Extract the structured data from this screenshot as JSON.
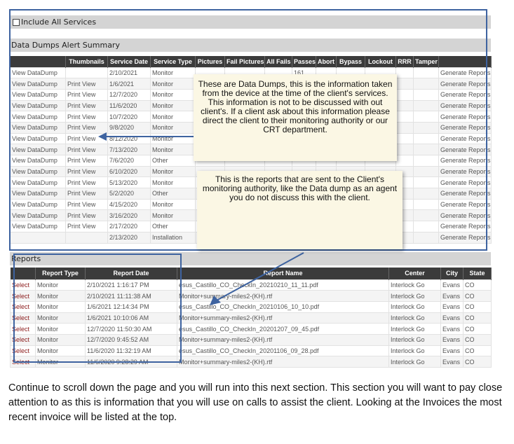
{
  "include_toggle": {
    "label": "Include All Services"
  },
  "data_dumps": {
    "title": "Data Dumps Alert Summary",
    "columns": [
      "",
      "Thumbnails",
      "Service Date",
      "Service Type",
      "Pictures",
      "Fail Pictures",
      "All Fails",
      "Passes",
      "Abort",
      "Bypass",
      "Lockout",
      "RRR",
      "Tamper",
      ""
    ],
    "rows": [
      {
        "view": "View DataDump",
        "thumb": "",
        "date": "2/10/2021",
        "type": "Monitor",
        "passes": "161",
        "gen": "Generate Reports"
      },
      {
        "view": "View DataDump",
        "thumb": "Print View",
        "date": "1/6/2021",
        "type": "Monitor",
        "passes": "",
        "gen": "Generate Reports"
      },
      {
        "view": "View DataDump",
        "thumb": "Print View",
        "date": "12/7/2020",
        "type": "Monitor",
        "passes": "",
        "gen": "Generate Reports"
      },
      {
        "view": "View DataDump",
        "thumb": "Print View",
        "date": "11/6/2020",
        "type": "Monitor",
        "passes": "",
        "gen": "Generate Reports"
      },
      {
        "view": "View DataDump",
        "thumb": "Print View",
        "date": "10/7/2020",
        "type": "Monitor",
        "passes": "",
        "gen": "Generate Reports"
      },
      {
        "view": "View DataDump",
        "thumb": "Print View",
        "date": "9/8/2020",
        "type": "Monitor",
        "passes": "",
        "gen": "Generate Reports"
      },
      {
        "view": "View DataDump",
        "thumb": "Print View",
        "date": "8/12/2020",
        "type": "Monitor",
        "passes": "",
        "gen": "Generate Reports"
      },
      {
        "view": "View DataDump",
        "thumb": "Print View",
        "date": "7/13/2020",
        "type": "Monitor",
        "passes": "",
        "gen": "Generate Reports"
      },
      {
        "view": "View DataDump",
        "thumb": "Print View",
        "date": "7/6/2020",
        "type": "Other",
        "passes": "",
        "gen": "Generate Reports"
      },
      {
        "view": "View DataDump",
        "thumb": "Print View",
        "date": "6/10/2020",
        "type": "Monitor",
        "passes": "",
        "gen": "Generate Reports"
      },
      {
        "view": "View DataDump",
        "thumb": "Print View",
        "date": "5/13/2020",
        "type": "Monitor",
        "passes": "",
        "gen": "Generate Reports"
      },
      {
        "view": "View DataDump",
        "thumb": "Print View",
        "date": "5/2/2020",
        "type": "Other",
        "passes": "",
        "gen": "Generate Reports"
      },
      {
        "view": "View DataDump",
        "thumb": "Print View",
        "date": "4/15/2020",
        "type": "Monitor",
        "passes": "",
        "gen": "Generate Reports"
      },
      {
        "view": "View DataDump",
        "thumb": "Print View",
        "date": "3/16/2020",
        "type": "Monitor",
        "passes": "",
        "gen": "Generate Reports"
      },
      {
        "view": "View DataDump",
        "thumb": "Print View",
        "date": "2/17/2020",
        "type": "Other",
        "passes": "",
        "gen": "Generate Reports"
      },
      {
        "view": "",
        "thumb": "",
        "date": "2/13/2020",
        "type": "Installation",
        "passes": "",
        "gen": "Generate Reports"
      }
    ]
  },
  "reports": {
    "title": "Reports",
    "columns": [
      "",
      "Report Type",
      "Report Date",
      "Report Name",
      "Center",
      "City",
      "State"
    ],
    "rows": [
      {
        "sel": "Select",
        "type": "Monitor",
        "date": "2/10/2021 1:16:17 PM",
        "name": "esus_Castillo_CO_CheckIn_20210210_11_11.pdf",
        "center": "Interlock Go",
        "city": "Evans",
        "state": "CO"
      },
      {
        "sel": "Select",
        "type": "Monitor",
        "date": "2/10/2021 11:11:38 AM",
        "name": "Monitor+summary-miles2-(KH).rtf",
        "center": "Interlock Go",
        "city": "Evans",
        "state": "CO"
      },
      {
        "sel": "Select",
        "type": "Monitor",
        "date": "1/6/2021 12:14:34 PM",
        "name": "esus_Castillo_CO_CheckIn_20210106_10_10.pdf",
        "center": "Interlock Go",
        "city": "Evans",
        "state": "CO"
      },
      {
        "sel": "Select",
        "type": "Monitor",
        "date": "1/6/2021 10:10:06 AM",
        "name": "Monitor+summary-miles2-(KH).rtf",
        "center": "Interlock Go",
        "city": "Evans",
        "state": "CO"
      },
      {
        "sel": "Select",
        "type": "Monitor",
        "date": "12/7/2020 11:50:30 AM",
        "name": "esus_Castillo_CO_CheckIn_20201207_09_45.pdf",
        "center": "Interlock Go",
        "city": "Evans",
        "state": "CO"
      },
      {
        "sel": "Select",
        "type": "Monitor",
        "date": "12/7/2020 9:45:52 AM",
        "name": "Monitor+summary-miles2-(KH).rtf",
        "center": "Interlock Go",
        "city": "Evans",
        "state": "CO"
      },
      {
        "sel": "Select",
        "type": "Monitor",
        "date": "11/6/2020 11:32:19 AM",
        "name": "esus_Castillo_CO_CheckIn_20201106_09_28.pdf",
        "center": "Interlock Go",
        "city": "Evans",
        "state": "CO"
      },
      {
        "sel": "Select",
        "type": "Monitor",
        "date": "11/6/2020 9:28:29 AM",
        "name": "Monitor+summary-miles2-(KH).rtf",
        "center": "Interlock Go",
        "city": "Evans",
        "state": "CO"
      }
    ]
  },
  "annotations": {
    "data_dumps_note": "These are Data Dumps, this is the information taken from the device at the time of the client's services. This information is not to be discussed with out client's. If a client ask about this information please direct the client to their monitoring authority or our CRT department.",
    "reports_note": "This is the reports that are sent to the Client's monitoring authority, like the Data dump as an agent you do not discuss this with the client."
  },
  "caption": "Continue to scroll down the page and you will run into this next section.  This section you will want to pay close attention to as this is information that you will use on calls to assist the client. Looking at the Invoices the most recent invoice will be listed at the top.",
  "colors": {
    "header": "#3b3b3b",
    "link": "#8b1a1a",
    "generate": "#dd2222",
    "annotation_border": "#3e63a0",
    "note_bg": "#fbf7e4"
  }
}
